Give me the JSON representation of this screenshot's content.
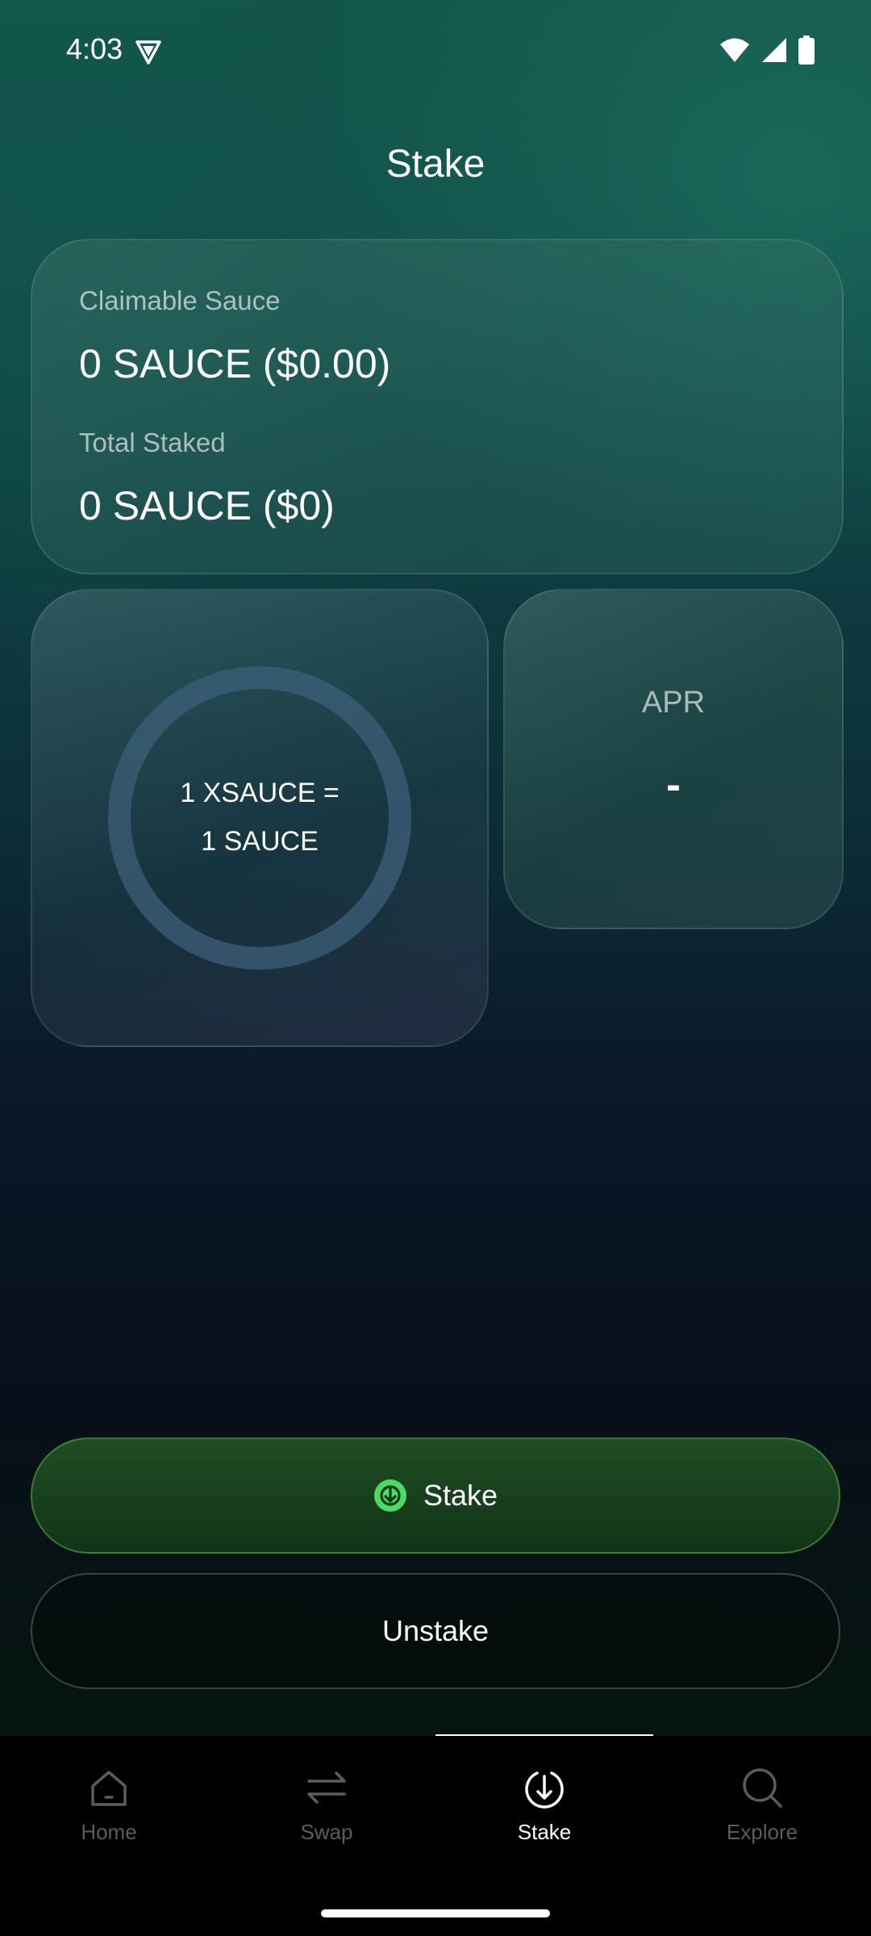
{
  "status_bar": {
    "time": "4:03"
  },
  "header": {
    "title": "Stake"
  },
  "summary_card": {
    "claimable_label": "Claimable Sauce",
    "claimable_value": "0 SAUCE ($0.00)",
    "total_staked_label": "Total Staked",
    "total_staked_value": "0 SAUCE ($0)"
  },
  "ratio_card": {
    "line1": "1 XSAUCE =",
    "line2": "1 SAUCE"
  },
  "apr_card": {
    "label": "APR",
    "value": "-"
  },
  "actions": {
    "stake_label": "Stake",
    "unstake_label": "Unstake"
  },
  "tab_bar": {
    "tabs": [
      {
        "label": "Home",
        "icon": "home-icon",
        "active": false
      },
      {
        "label": "Swap",
        "icon": "swap-arrows-icon",
        "active": false
      },
      {
        "label": "Stake",
        "icon": "stake-download-icon",
        "active": true
      },
      {
        "label": "Explore",
        "icon": "search-icon",
        "active": false
      }
    ]
  },
  "colors": {
    "stake_button": "#1f4e22",
    "stake_icon": "#4cd964",
    "tab_inactive": "#5c5c5c"
  }
}
